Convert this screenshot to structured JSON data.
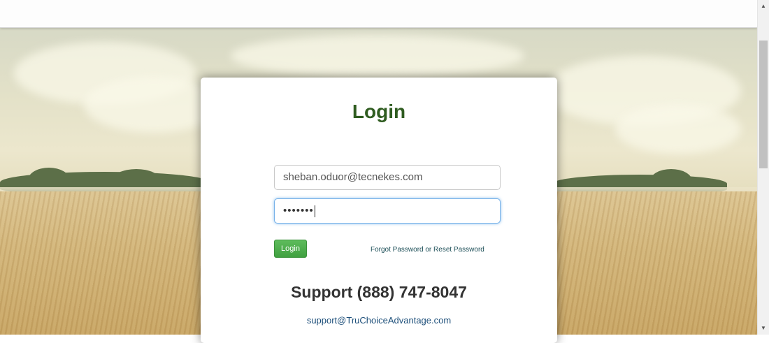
{
  "login": {
    "title": "Login",
    "email_value": "sheban.oduor@tecnekes.com",
    "password_mask": "•••••••",
    "login_button": "Login",
    "forgot_link": "Forgot Password or Reset Password"
  },
  "support": {
    "phone_text": "Support (888) 747-8047",
    "email": "support@TruChoiceAdvantage.com"
  },
  "scrollbar": {
    "up_glyph": "▲",
    "down_glyph": "▼"
  },
  "colors": {
    "title_green": "#2f5c20",
    "button_green": "#4cae4c",
    "link_teal": "#1d4f58"
  }
}
